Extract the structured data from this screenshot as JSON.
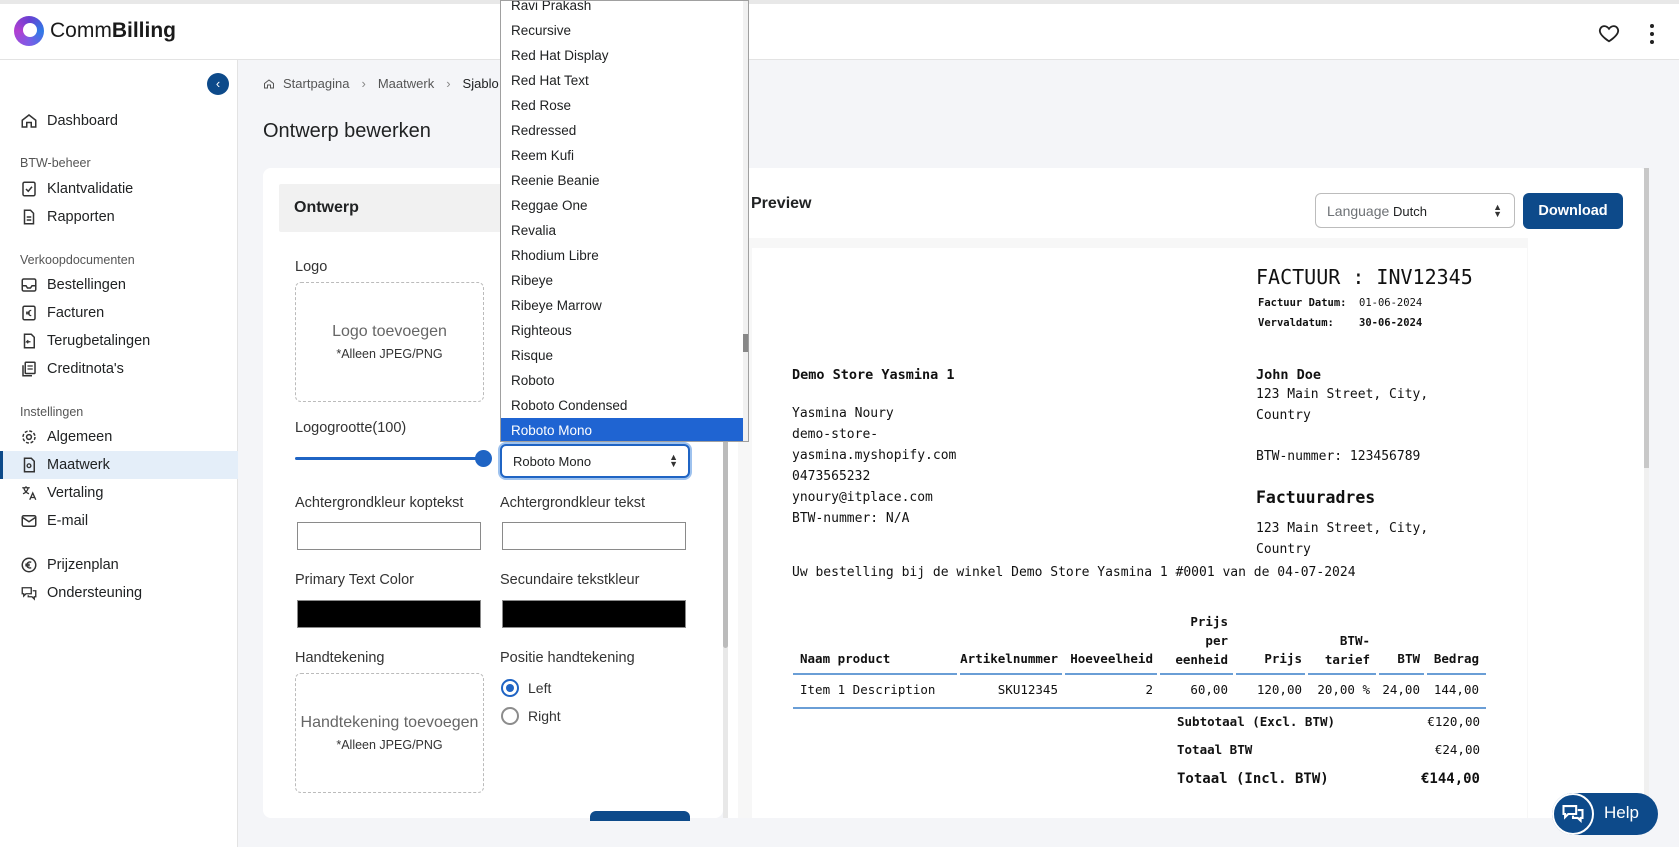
{
  "app": {
    "brand_prefix": "Comm",
    "brand_bold": "Billing"
  },
  "sidebar": {
    "collapse_glyph": "‹",
    "top": {
      "label": "Dashboard",
      "icon": "home-icon"
    },
    "sections": [
      {
        "title": "BTW-beheer",
        "items": [
          {
            "label": "Klantvalidatie",
            "icon": "check-document-icon"
          },
          {
            "label": "Rapporten",
            "icon": "document-icon"
          }
        ]
      },
      {
        "title": "Verkoopdocumenten",
        "items": [
          {
            "label": "Bestellingen",
            "icon": "inbox-icon"
          },
          {
            "label": "Facturen",
            "icon": "currency-document-icon"
          },
          {
            "label": "Terugbetalingen",
            "icon": "refund-icon"
          },
          {
            "label": "Creditnota's",
            "icon": "credit-note-icon"
          }
        ]
      },
      {
        "title": "Instellingen",
        "items": [
          {
            "label": "Algemeen",
            "icon": "gear-icon"
          },
          {
            "label": "Maatwerk",
            "icon": "custom-document-icon",
            "active": true
          },
          {
            "label": "Vertaling",
            "icon": "translate-icon"
          },
          {
            "label": "E-mail",
            "icon": "mail-icon"
          }
        ]
      }
    ],
    "bottom": [
      {
        "label": "Prijzenplan",
        "icon": "euro-icon"
      },
      {
        "label": "Ondersteuning",
        "icon": "chat-icon"
      }
    ]
  },
  "breadcrumb": {
    "home": "Startpagina",
    "second": "Maatwerk",
    "third": "Sjablo"
  },
  "page_title": "Ontwerp bewerken",
  "design": {
    "header": "Ontwerp",
    "logo_label": "Logo",
    "logo_add": "Logo toevoegen",
    "logo_hint": "*Alleen JPEG/PNG",
    "logo_size_label": "Logogrootte(100)",
    "logo_size_value": 100,
    "font_selected": "Roboto Mono",
    "header_bg_label": "Achtergrondkleur koptekst",
    "text_bg_label": "Achtergrondkleur tekst",
    "primary_text_label": "Primary Text Color",
    "secondary_text_label": "Secundaire tekstkleur",
    "primary_text_color": "#000000",
    "secondary_text_color": "#000000",
    "signature_label": "Handtekening",
    "signature_add": "Handtekening toevoegen",
    "signature_hint": "*Alleen JPEG/PNG",
    "signature_position_label": "Positie handtekening",
    "position_left": "Left",
    "position_right": "Right",
    "position_selected": "Left"
  },
  "font_dropdown": {
    "options": [
      "Ravi Prakash",
      "Recursive",
      "Red Hat Display",
      "Red Hat Text",
      "Red Rose",
      "Redressed",
      "Reem Kufi",
      "Reenie Beanie",
      "Reggae One",
      "Revalia",
      "Rhodium Libre",
      "Ribeye",
      "Ribeye Marrow",
      "Righteous",
      "Risque",
      "Roboto",
      "Roboto Condensed",
      "Roboto Mono"
    ],
    "selected": "Roboto Mono"
  },
  "preview": {
    "title": "Preview",
    "language_label": "Language",
    "language_value": "Dutch",
    "download_label": "Download"
  },
  "invoice": {
    "title": "FACTUUR : INV12345",
    "date_label": "Factuur Datum:",
    "date_value": "01-06-2024",
    "due_label": "Vervaldatum:",
    "due_value": "30-06-2024",
    "store_name": "Demo Store Yasmina 1",
    "store_lines": [
      "Yasmina Noury",
      "demo-store-",
      "yasmina.myshopify.com",
      "0473565232",
      "ynoury@itplace.com",
      "BTW-nummer: N/A"
    ],
    "customer_name": "John Doe",
    "customer_lines": [
      "123 Main Street, City,",
      "Country"
    ],
    "customer_vat": "BTW-nummer: 123456789",
    "billing_title": "Factuuradres",
    "billing_lines": [
      "123 Main Street, City,",
      "Country"
    ],
    "order_line": "Uw bestelling bij de winkel Demo Store Yasmina 1 #0001 van de 04-07-2024",
    "columns": [
      "Naam product",
      "Artikelnummer",
      "Hoeveelheid",
      "Prijs per eenheid",
      "Prijs",
      "BTW-tarief",
      "BTW",
      "Bedrag"
    ],
    "rows": [
      {
        "name": "Item 1 Description",
        "sku": "SKU12345",
        "qty": "2",
        "unit": "60,00",
        "price": "120,00",
        "rate": "20,00 %",
        "vat": "24,00",
        "amount": "144,00"
      }
    ],
    "subtotal_label": "Subtotaal (Excl. BTW)",
    "subtotal_value": "€120,00",
    "vat_total_label": "Totaal BTW",
    "vat_total_value": "€24,00",
    "total_label": "Totaal (Incl. BTW)",
    "total_value": "€144,00"
  },
  "help": {
    "label": "Help"
  },
  "colors": {
    "primary": "#0d4a8a",
    "accent": "#1f64c4",
    "active_nav_bg": "#e4eef9"
  }
}
